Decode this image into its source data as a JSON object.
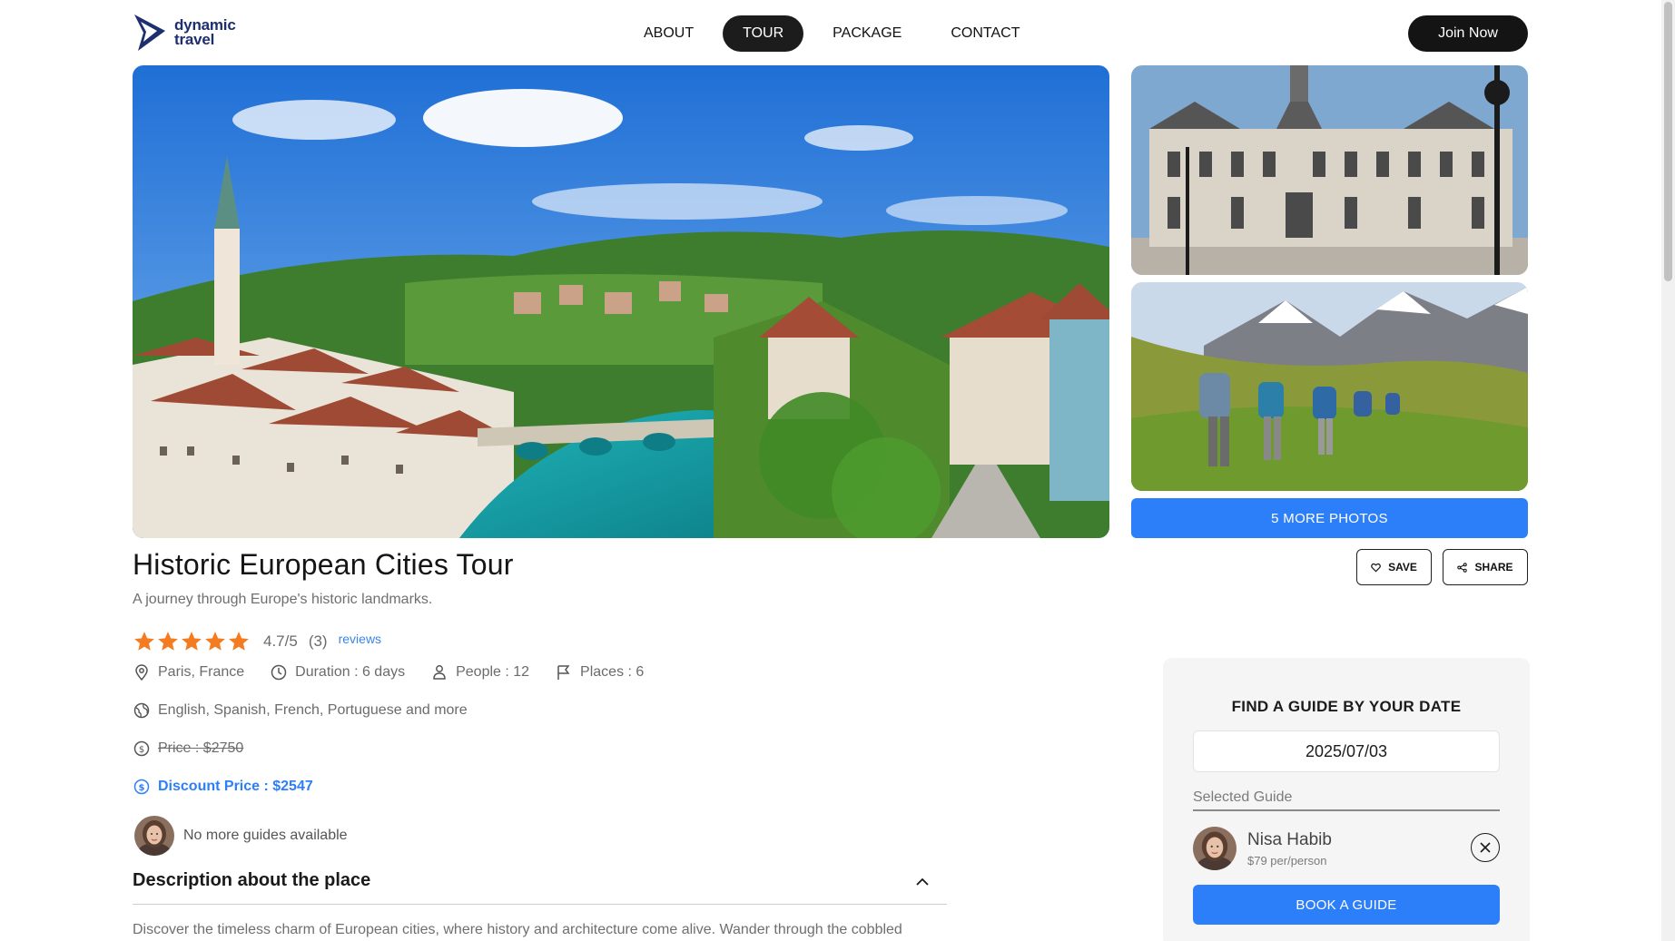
{
  "brand": {
    "line1": "dynamic",
    "line2": "travel"
  },
  "nav": {
    "items": [
      {
        "label": "ABOUT",
        "active": false
      },
      {
        "label": "TOUR",
        "active": true
      },
      {
        "label": "PACKAGE",
        "active": false
      },
      {
        "label": "CONTACT",
        "active": false
      }
    ],
    "join_label": "Join Now"
  },
  "gallery": {
    "more_photos_label": "5 MORE PHOTOS",
    "save_label": "SAVE",
    "share_label": "SHARE"
  },
  "tour": {
    "title": "Historic European Cities Tour",
    "subtitle": "A journey through Europe's historic landmarks.",
    "rating": "4.7/5",
    "rating_count": "(3)",
    "reviews_label": "reviews",
    "stars": 5,
    "location": "Paris, France",
    "duration": "Duration : 6 days",
    "people": "People : 12",
    "places": "Places : 6",
    "languages": "English, Spanish, French, Portuguese and more",
    "price": "Price : $2750",
    "discount_price": "Discount Price : $2547",
    "guides_status": "No more guides available"
  },
  "description": {
    "heading": "Description about the place",
    "text": "Discover the timeless charm of European cities, where history and architecture come alive. Wander through the cobbled"
  },
  "guide_panel": {
    "title": "FIND A GUIDE BY YOUR DATE",
    "date": "2025/07/03",
    "selected_label": "Selected Guide",
    "guide_name": "Nisa Habib",
    "guide_price": "$79 per/person",
    "book_label": "BOOK A GUIDE"
  },
  "colors": {
    "accent": "#2d7ff9",
    "dark": "#141414",
    "star": "#f47b20"
  }
}
